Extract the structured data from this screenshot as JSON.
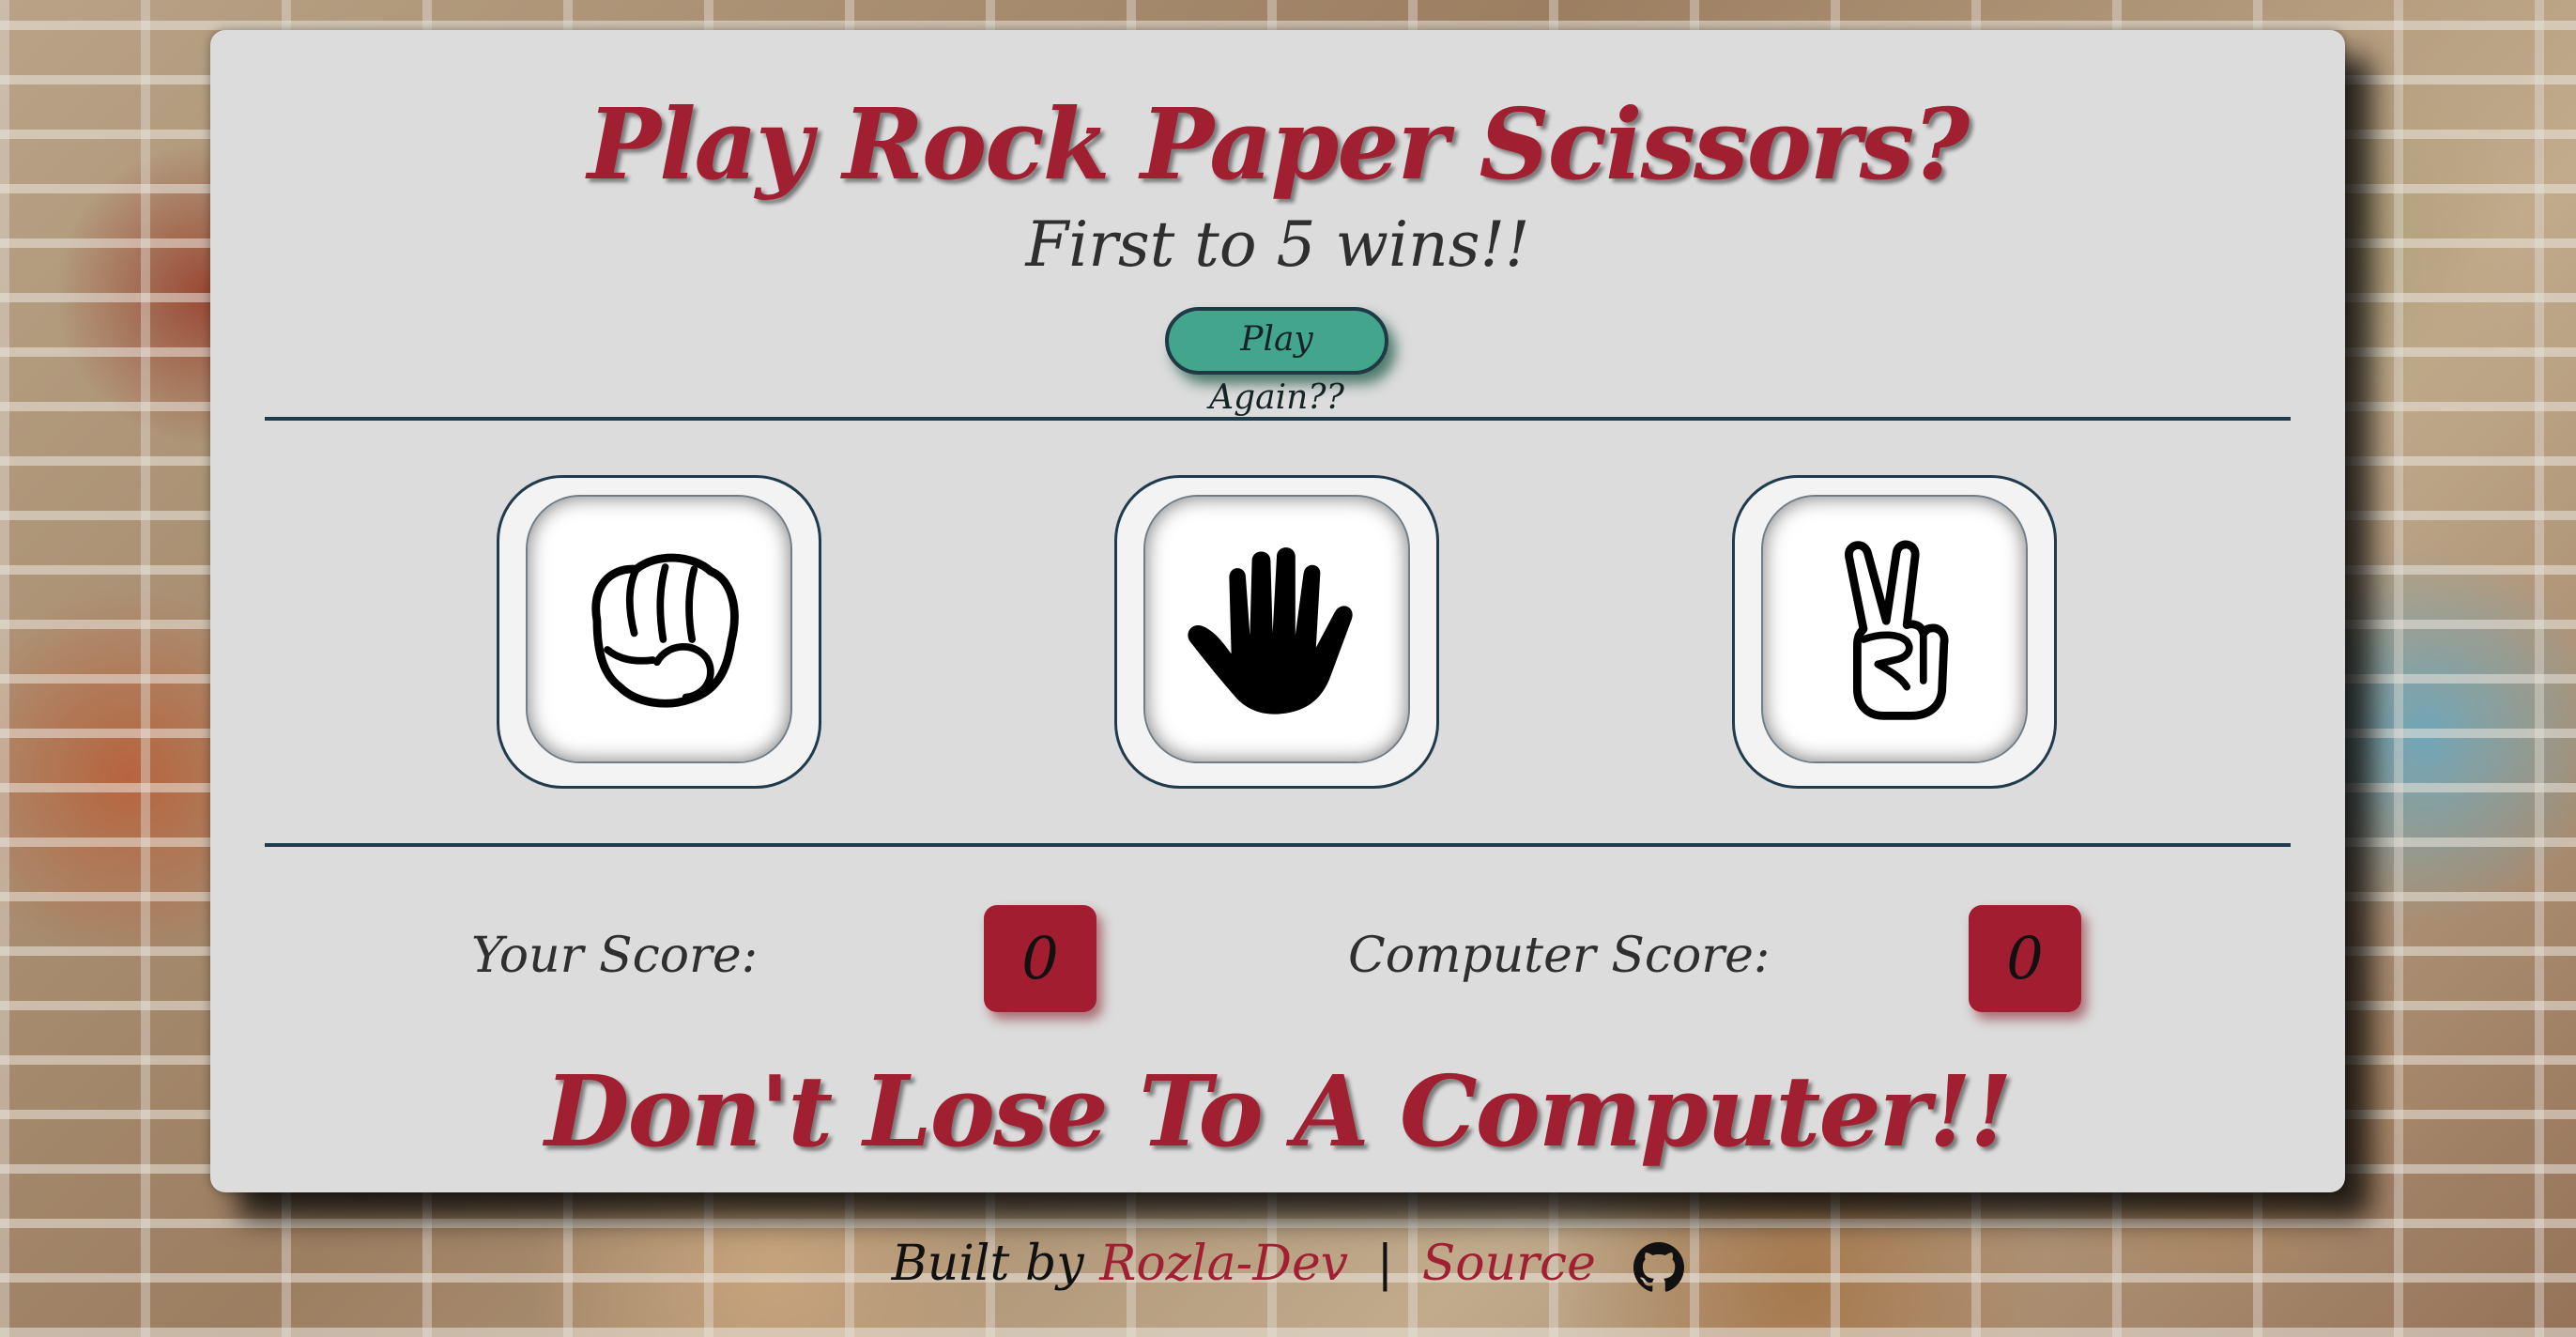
{
  "header": {
    "title": "Play Rock Paper Scissors?",
    "subtitle": "First to 5 wins!!",
    "play_again_label": "Play Again??"
  },
  "choices": [
    {
      "id": "rock",
      "icon": "fist-icon"
    },
    {
      "id": "paper",
      "icon": "open-hand-icon"
    },
    {
      "id": "scissors",
      "icon": "peace-sign-icon"
    }
  ],
  "scores": {
    "player_label": "Your Score:",
    "player_value": "0",
    "computer_label": "Computer Score:",
    "computer_value": "0"
  },
  "message": "Don't Lose To A Computer!!",
  "footer": {
    "built_by": "Built by",
    "author": "Rozla-Dev",
    "separator": "|",
    "source": "Source",
    "icon": "github-icon"
  },
  "colors": {
    "accent": "#a01f30",
    "button": "#43a68c",
    "panel": "#dcdcdc",
    "divider": "#1f3b4c"
  }
}
